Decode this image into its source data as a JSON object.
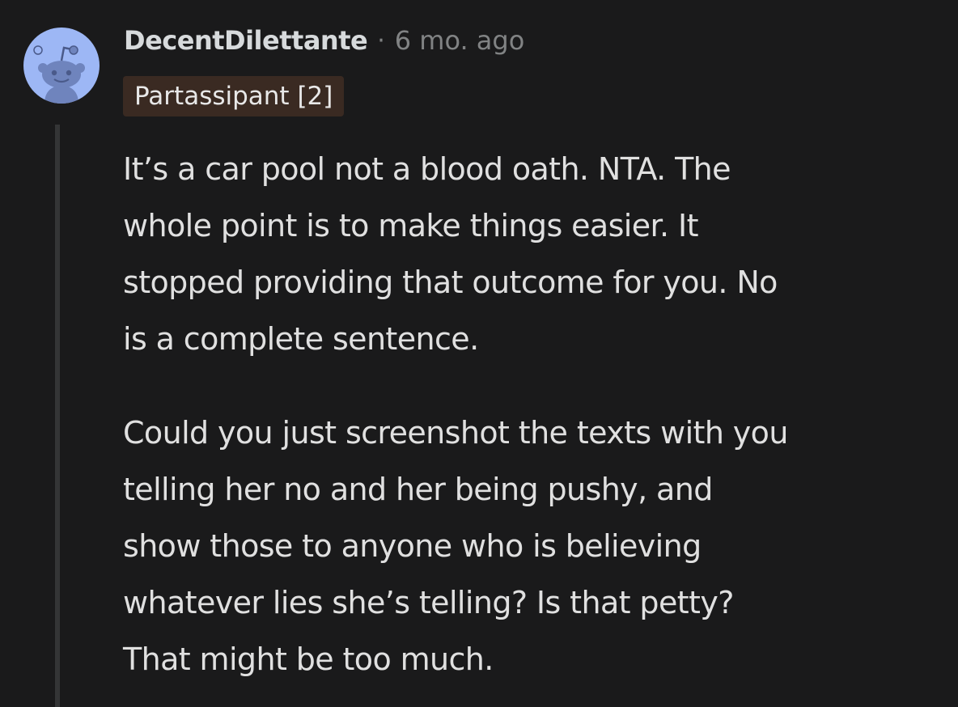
{
  "comment": {
    "author": "DecentDilettante",
    "separator": "·",
    "timestamp": "6 mo. ago",
    "flair": "Partassipant [2]",
    "paragraphs": [
      {
        "lines": [
          "It’s a car pool not a blood oath. NTA. The",
          "whole point is to make things easier. It",
          "stopped providing that outcome for you. No",
          "is a complete sentence."
        ]
      },
      {
        "lines": [
          "Could you just screenshot the texts with you",
          "telling her no and her being pushy, and",
          "show those to anyone who is believing",
          "whatever lies she’s telling? Is that petty?",
          "That might be too much."
        ]
      }
    ]
  },
  "icons": {
    "avatar": "snoo-avatar-icon"
  },
  "colors": {
    "background": "#1a1a1b",
    "avatar_bg": "#9db7f5",
    "flair_bg": "#3a2a22",
    "muted_text": "#818384",
    "thread_line": "#343536"
  }
}
